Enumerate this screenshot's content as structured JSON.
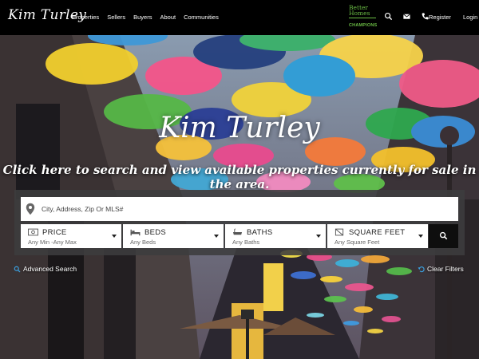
{
  "header": {
    "logo": "Kim Turley",
    "nav": [
      "Properties",
      "Sellers",
      "Buyers",
      "About",
      "Communities"
    ],
    "brand": {
      "line1": "Better",
      "line2": "Homes",
      "champions": "CHAMPIONS"
    },
    "icons": [
      "search-icon",
      "envelope-icon",
      "phone-icon"
    ],
    "register": "Register",
    "login": "Login"
  },
  "hero": {
    "title": "Kim Turley",
    "subtitle": "Click here to search and view available properties currently for sale in the area."
  },
  "search": {
    "placeholder": "City, Address, Zip Or MLS#",
    "filters": [
      {
        "label": "PRICE",
        "value": "Any Min -Any Max",
        "icon": "money-icon"
      },
      {
        "label": "BEDS",
        "value": "Any Beds",
        "icon": "bed-icon"
      },
      {
        "label": "BATHS",
        "value": "Any Baths",
        "icon": "bath-icon"
      },
      {
        "label": "SQUARE FEET",
        "value": "Any Square Feet",
        "icon": "square-feet-icon"
      }
    ],
    "go_icon": "search-icon"
  },
  "links": {
    "advanced": "Advanced Search",
    "clear": "Clear Filters"
  },
  "colors": {
    "header_bg": "#000000",
    "brand_green": "#6bbd45",
    "panel_bg": "#3c3c3e",
    "button_bg": "#0e0e0e"
  }
}
